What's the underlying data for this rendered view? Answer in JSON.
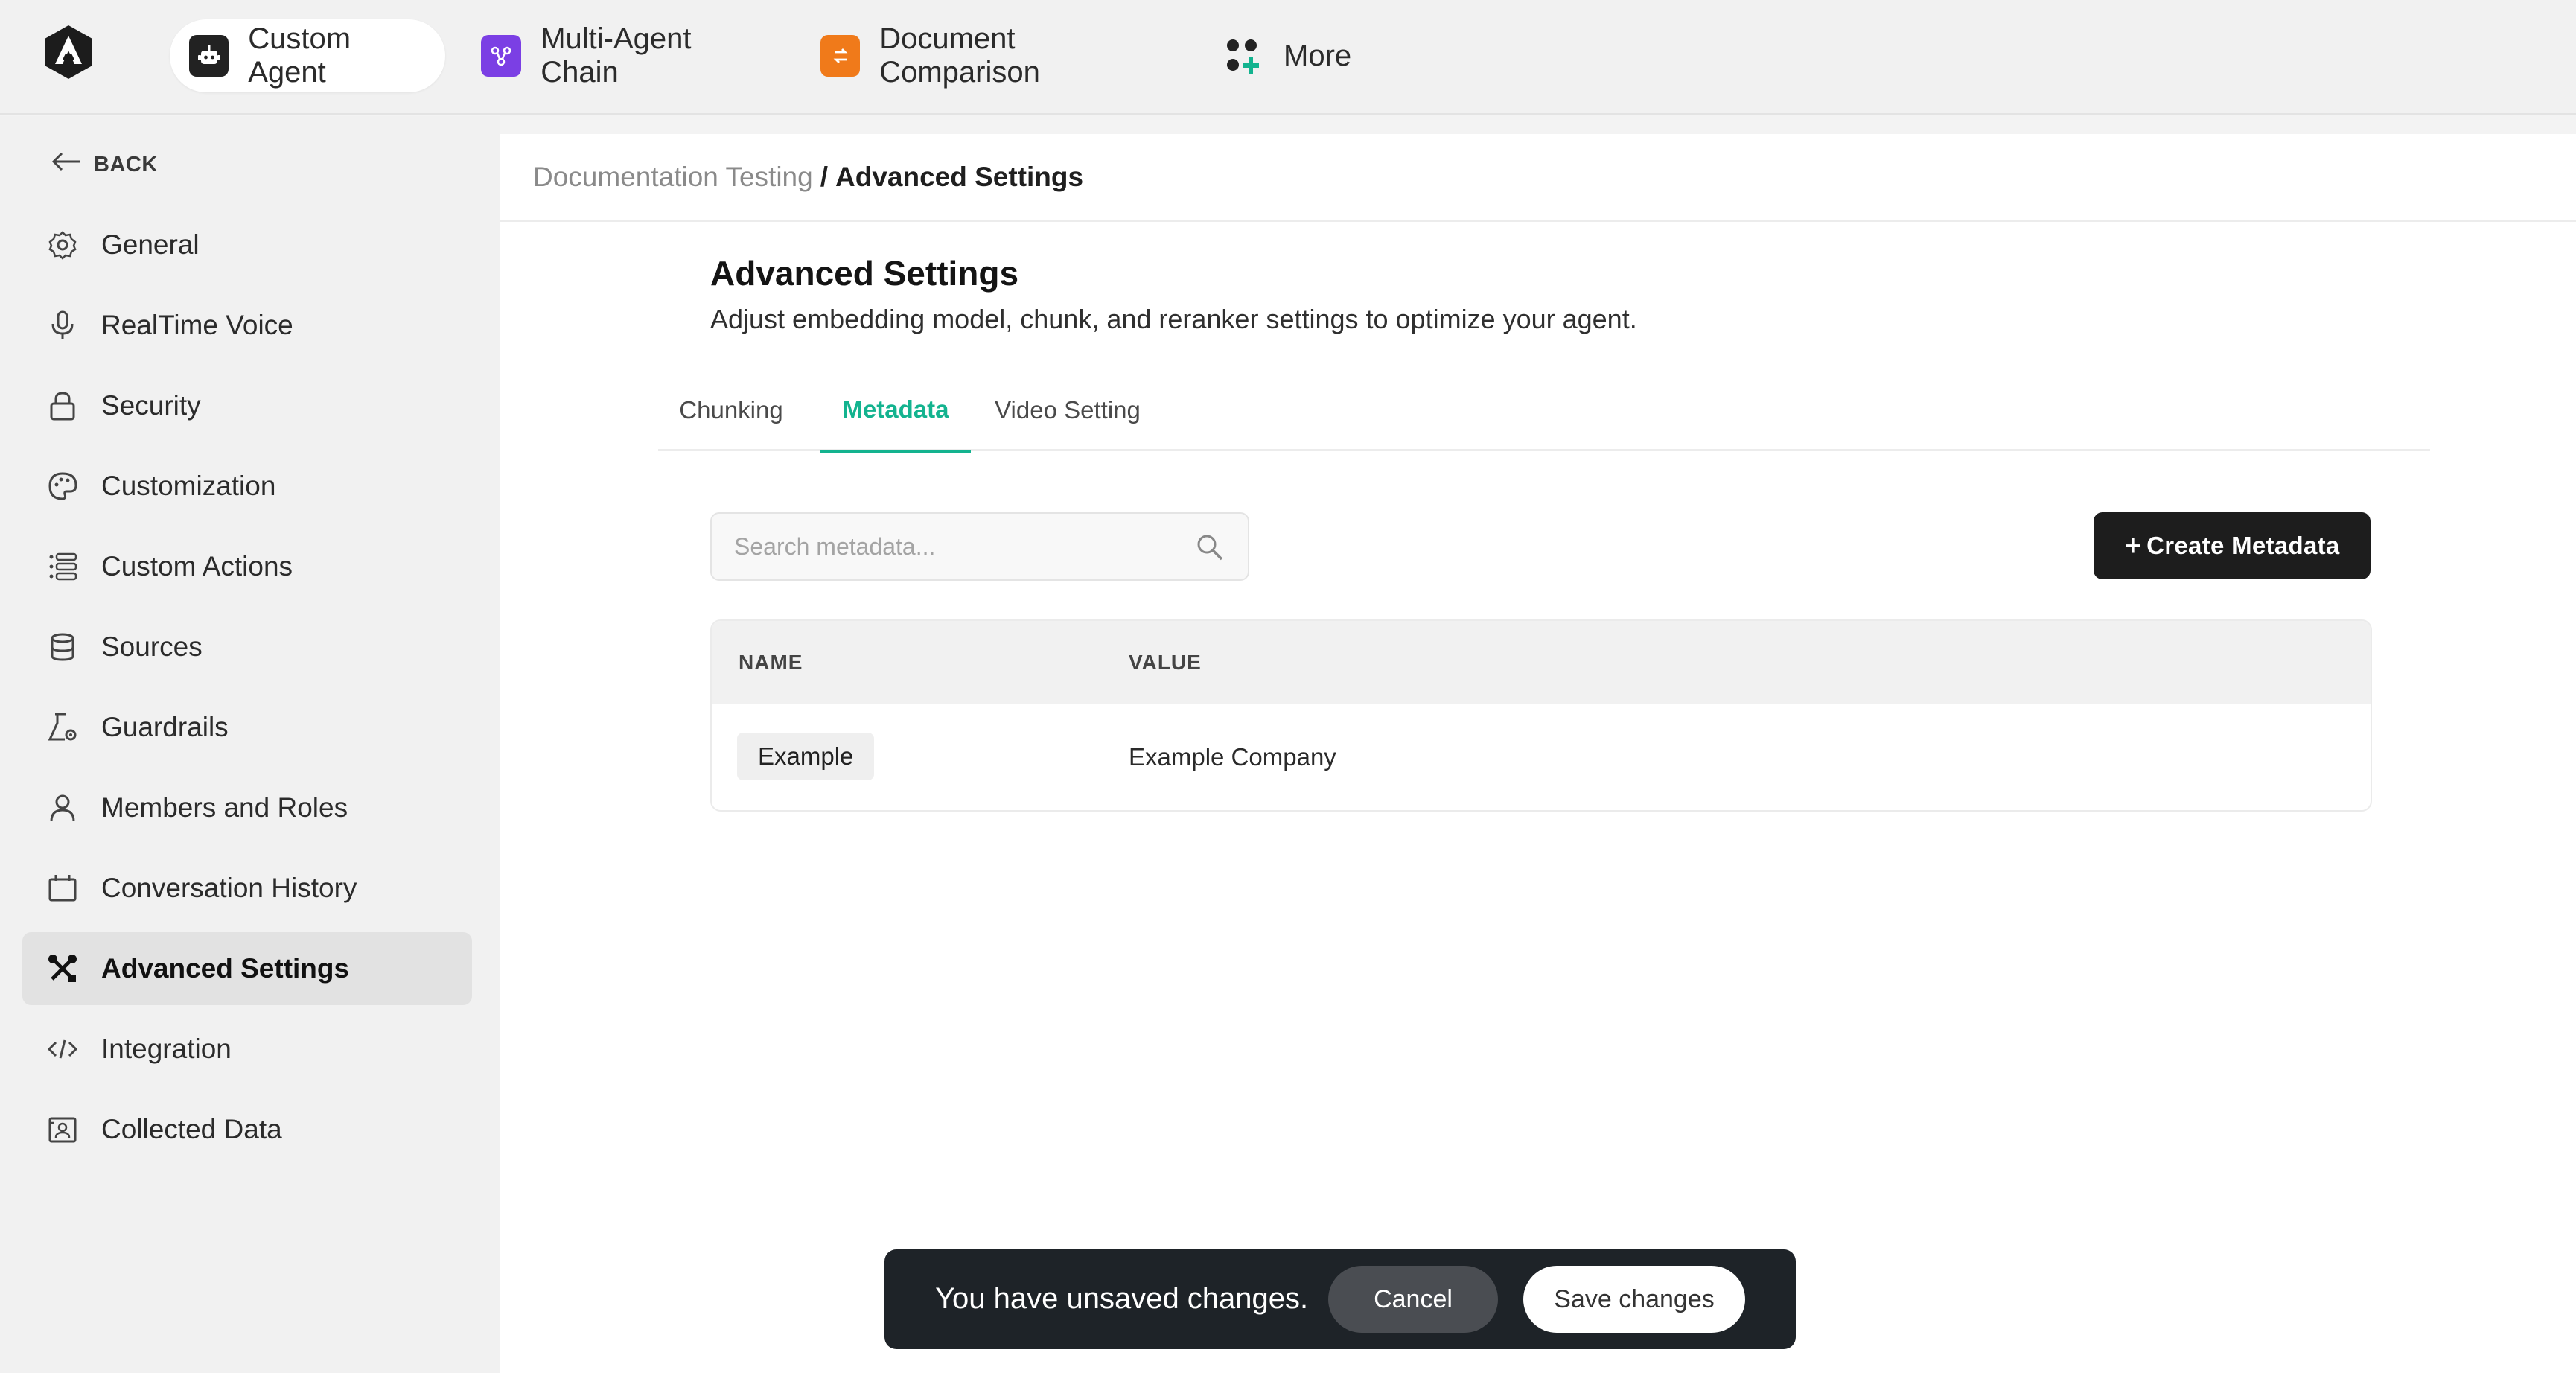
{
  "colors": {
    "accent": "#13b38f",
    "dark": "#1d1d1d",
    "toast_bg": "#1e2328",
    "multi_agent_icon": "#7b3fe4",
    "doc_compare_icon": "#f07a1a"
  },
  "topnav": {
    "logo_icon": "app-logo-icon",
    "items": [
      {
        "label": "Custom Agent",
        "icon": "robot-icon",
        "active": true
      },
      {
        "label": "Multi-Agent Chain",
        "icon": "chain-icon",
        "active": false
      },
      {
        "label": "Document Comparison",
        "icon": "compare-icon",
        "active": false
      },
      {
        "label": "More",
        "icon": "grid-plus-icon",
        "active": false
      }
    ]
  },
  "sidebar": {
    "back_label": "BACK",
    "items": [
      {
        "label": "General",
        "icon": "gear-icon",
        "active": false
      },
      {
        "label": "RealTime Voice",
        "icon": "microphone-icon",
        "active": false
      },
      {
        "label": "Security",
        "icon": "lock-icon",
        "active": false
      },
      {
        "label": "Customization",
        "icon": "palette-icon",
        "active": false
      },
      {
        "label": "Custom Actions",
        "icon": "list-icon",
        "active": false
      },
      {
        "label": "Sources",
        "icon": "database-icon",
        "active": false
      },
      {
        "label": "Guardrails",
        "icon": "flask-gear-icon",
        "active": false
      },
      {
        "label": "Members and Roles",
        "icon": "user-icon",
        "active": false
      },
      {
        "label": "Conversation History",
        "icon": "calendar-icon",
        "active": false
      },
      {
        "label": "Advanced Settings",
        "icon": "tools-icon",
        "active": true
      },
      {
        "label": "Integration",
        "icon": "code-icon",
        "active": false
      },
      {
        "label": "Collected Data",
        "icon": "contact-card-icon",
        "active": false
      }
    ]
  },
  "breadcrumb": {
    "parent": "Documentation Testing",
    "separator": "/",
    "current": "Advanced Settings"
  },
  "main": {
    "title": "Advanced Settings",
    "subtitle": "Adjust embedding model, chunk, and reranker settings to optimize your agent.",
    "tabs": [
      {
        "label": "Chunking",
        "active": false
      },
      {
        "label": "Metadata",
        "active": true
      },
      {
        "label": "Video Setting",
        "active": false
      }
    ],
    "search": {
      "placeholder": "Search metadata...",
      "value": ""
    },
    "create_button": {
      "plus": "+",
      "label": "Create Metadata"
    },
    "table": {
      "columns": [
        "NAME",
        "VALUE"
      ],
      "rows": [
        {
          "name": "Example",
          "value": "Example Company"
        }
      ]
    }
  },
  "toast": {
    "message": "You have unsaved changes.",
    "cancel_label": "Cancel",
    "save_label": "Save changes"
  }
}
